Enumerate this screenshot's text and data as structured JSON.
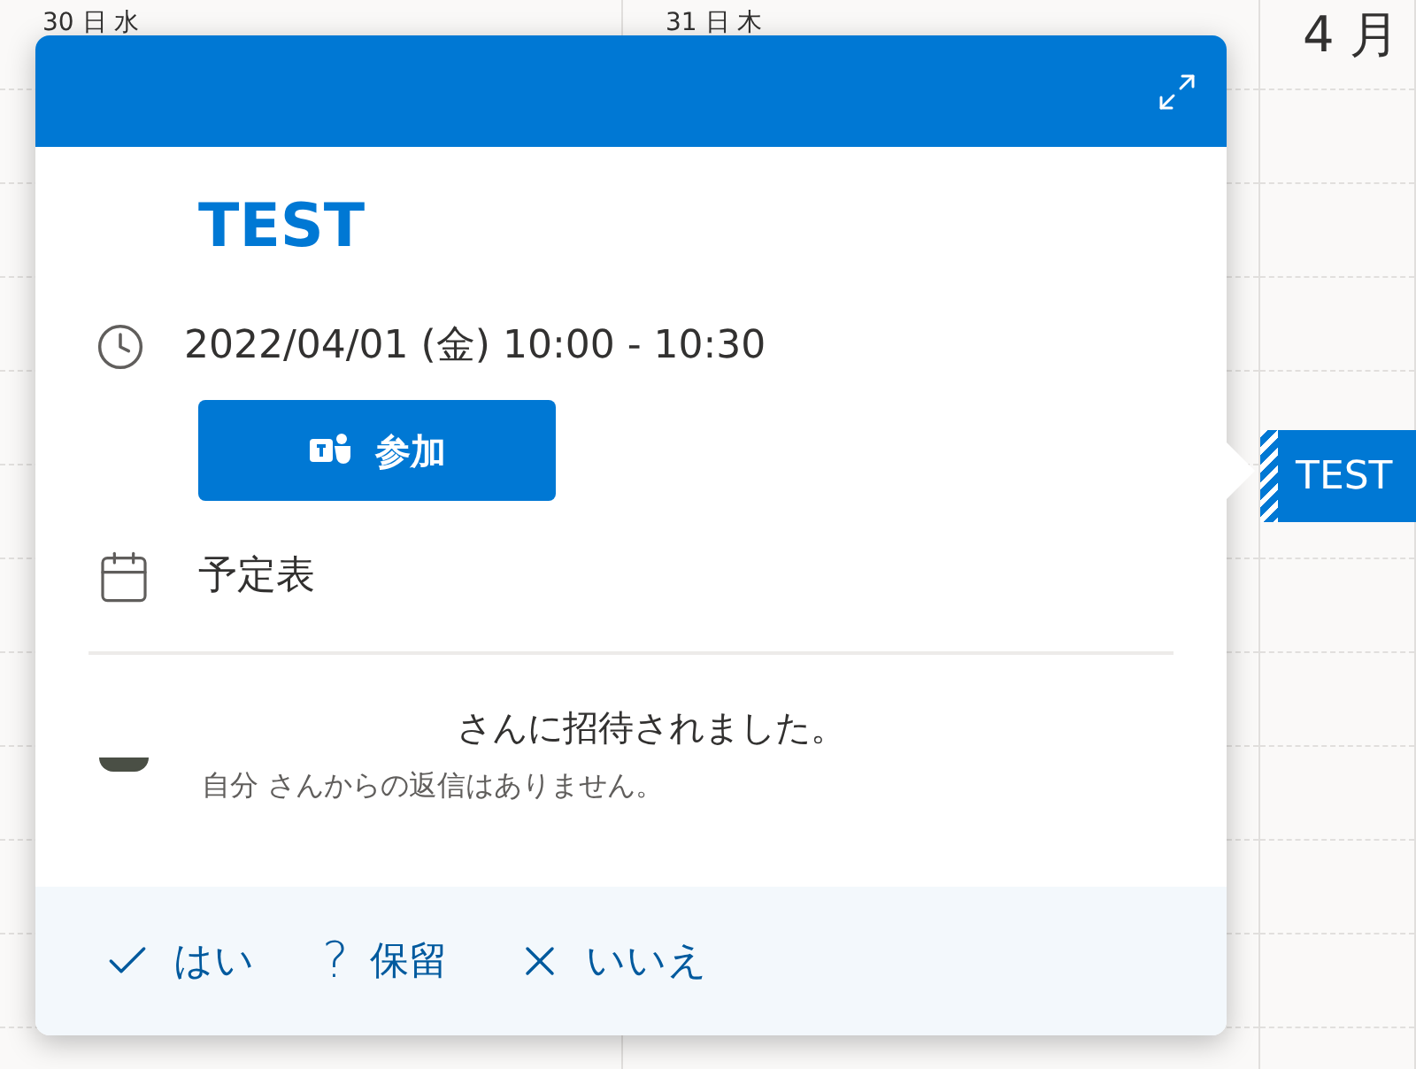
{
  "calendar": {
    "day_headers": [
      {
        "label": "30 日 水"
      },
      {
        "label": "31 日 木"
      },
      {
        "label": "4 月"
      }
    ],
    "event_chip": {
      "title": "TEST"
    }
  },
  "popup": {
    "title": "TEST",
    "time": "2022/04/01 (金) 10:00 - 10:30",
    "join_button": "参加",
    "calendar_name": "予定表",
    "invite_text": "さんに招待されました。",
    "reply_status": "自分 さんからの返信はありません。",
    "responses": [
      {
        "kind": "accept",
        "label": "はい"
      },
      {
        "kind": "tentative",
        "icon": "?",
        "label": "保留"
      },
      {
        "kind": "decline",
        "label": "いいえ"
      }
    ]
  }
}
